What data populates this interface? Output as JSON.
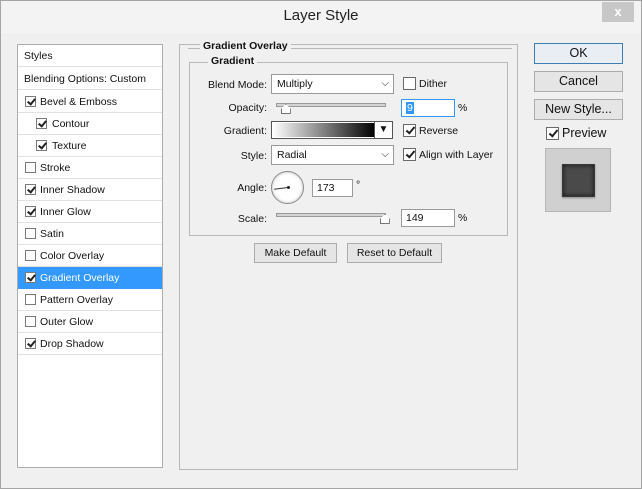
{
  "window": {
    "title": "Layer Style",
    "close_glyph": "x"
  },
  "styles_list": {
    "header": "Styles",
    "blending": "Blending Options: Custom",
    "items": [
      {
        "label": "Bevel & Emboss",
        "checked": true
      },
      {
        "label": "Contour",
        "checked": true
      },
      {
        "label": "Texture",
        "checked": true
      },
      {
        "label": "Stroke",
        "checked": false
      },
      {
        "label": "Inner Shadow",
        "checked": true
      },
      {
        "label": "Inner Glow",
        "checked": true
      },
      {
        "label": "Satin",
        "checked": false
      },
      {
        "label": "Color Overlay",
        "checked": false
      },
      {
        "label": "Gradient Overlay",
        "checked": true
      },
      {
        "label": "Pattern Overlay",
        "checked": false
      },
      {
        "label": "Outer Glow",
        "checked": false
      },
      {
        "label": "Drop Shadow",
        "checked": true
      }
    ]
  },
  "panel": {
    "group_title": "Gradient Overlay",
    "sub_title": "Gradient",
    "blend_mode_label": "Blend Mode:",
    "blend_mode_value": "Multiply",
    "dither_label": "Dither",
    "opacity_label": "Opacity:",
    "opacity_value": "9",
    "percent": "%",
    "gradient_label": "Gradient:",
    "reverse_label": "Reverse",
    "style_label": "Style:",
    "style_value": "Radial",
    "align_label": "Align with Layer",
    "angle_label": "Angle:",
    "angle_value": "173",
    "degree": "°",
    "scale_label": "Scale:",
    "scale_value": "149",
    "make_default": "Make Default",
    "reset_default": "Reset to Default",
    "dither_checked": false,
    "reverse_checked": true,
    "align_checked": true,
    "opacity_fraction": 0.09,
    "scale_fraction": 0.99
  },
  "right": {
    "ok": "OK",
    "cancel": "Cancel",
    "new_style": "New Style...",
    "preview_label": "Preview",
    "preview_checked": true
  },
  "colors": {
    "selection": "#3399ff"
  }
}
